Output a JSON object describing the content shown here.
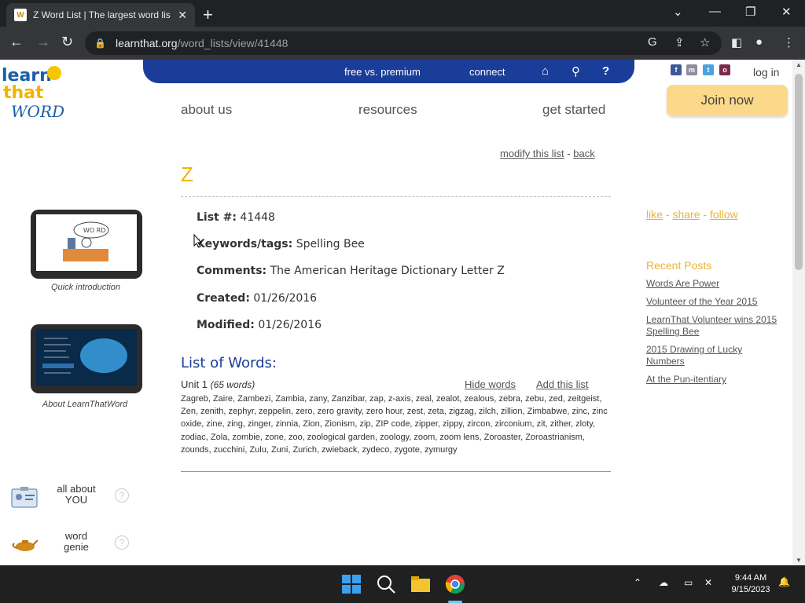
{
  "browser": {
    "tab_title": "Z Word List | The largest word lis",
    "url_host": "learnthat.org",
    "url_path": "/word_lists/view/41448"
  },
  "site": {
    "logo": [
      "learn",
      "that",
      "WORD"
    ],
    "topbar": {
      "free_vs_premium": "free vs. premium",
      "connect": "connect"
    },
    "login": "log in",
    "join": "Join now",
    "nav": {
      "about": "about us",
      "resources": "resources",
      "get_started": "get started"
    }
  },
  "list": {
    "modify": "modify this list",
    "separator": "-",
    "back": "back",
    "title": "Z",
    "list_no_label": "List #:",
    "list_no": "41448",
    "keywords_label": "Keywords/tags:",
    "keywords": "Spelling Bee",
    "comments_label": "Comments:",
    "comments": "The American Heritage Dictionary Letter Z",
    "created_label": "Created:",
    "created": "01/26/2016",
    "modified_label": "Modified:",
    "modified": "01/26/2016",
    "list_of_words": "List of Words:",
    "unit": "Unit 1",
    "unit_count": "(65 words)",
    "hide_words": "Hide words",
    "add_list": "Add this list",
    "words": "Zagreb, Zaire, Zambezi, Zambia, zany, Zanzibar, zap, z-axis, zeal, zealot, zealous, zebra, zebu, zed, zeitgeist, Zen, zenith, zephyr, zeppelin, zero, zero gravity, zero hour, zest, zeta, zigzag, zilch, zillion, Zimbabwe, zinc, zinc oxide, zine, zing, zinger, zinnia, Zion, Zionism, zip, ZIP code, zipper, zippy, zircon, zirconium, zit, zither, zloty, zodiac, Zola, zombie, zone, zoo, zoological garden, zoology, zoom, zoom lens, Zoroaster, Zoroastrianism, zounds, zucchini, Zulu, Zuni, Zurich, zwieback, zydeco, zygote, zymurgy"
  },
  "left": {
    "video1_caption": "Quick introduction",
    "video2_caption": "About LearnThatWord",
    "all_about_you": "all about YOU",
    "word_genie": "word genie",
    "help": "?"
  },
  "right": {
    "like": "like",
    "share": "share",
    "follow": "follow",
    "recent_title": "Recent Posts",
    "posts": [
      "Words Are Power",
      "Volunteer of the Year 2015",
      "LearnThat Volunteer wins 2015 Spelling Bee",
      "2015 Drawing of Lucky Numbers",
      "At the Pun-itentiary"
    ]
  },
  "taskbar": {
    "time": "9:44 AM",
    "date": "9/15/2023"
  }
}
